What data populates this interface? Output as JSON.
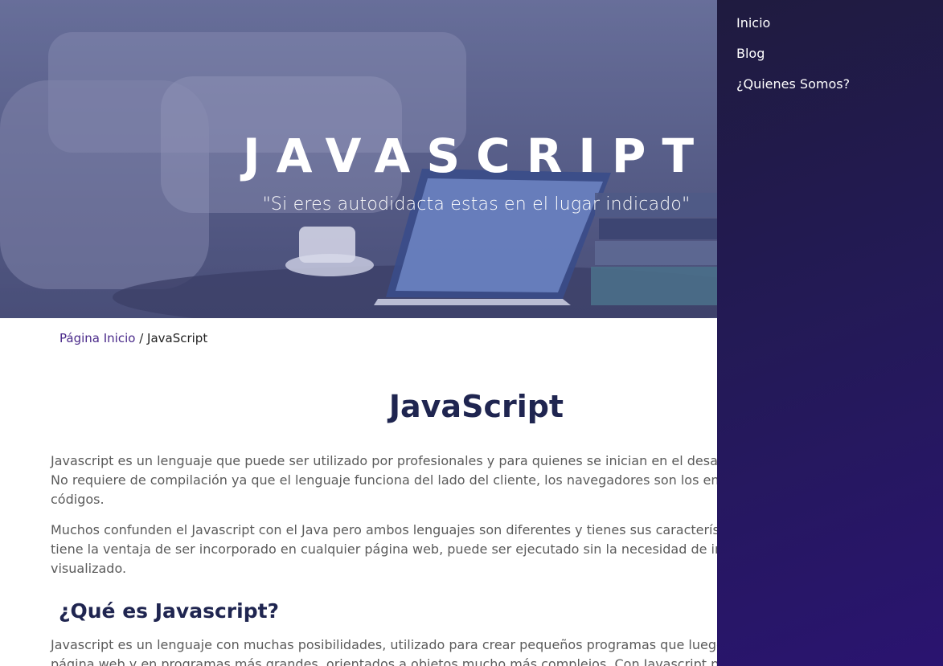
{
  "hero": {
    "title": "JAVASCRIPT",
    "subtitle": "\"Si eres autodidacta estas en el lugar indicado\""
  },
  "breadcrumb": {
    "home_label": "Página Inicio",
    "separator": " / ",
    "current": "JavaScript"
  },
  "main": {
    "title": "JavaScript",
    "paragraphs": [
      {
        "lines": [
          "Javascript es un lenguaje que puede ser utilizado por profesionales y para quienes se inician en el desarro",
          "No requiere de compilación ya que el lenguaje funciona del lado del cliente, los navegadores son los enca",
          "códigos."
        ]
      },
      {
        "lines": [
          "Muchos confunden el Javascript con el Java pero ambos lenguajes son diferentes y tienes sus característic",
          "tiene la ventaja de ser incorporado en cualquier página web, puede ser ejecutado sin la necesidad de inst",
          "visualizado."
        ]
      }
    ],
    "section_heading": "¿Qué es Javascript?",
    "section_paragraph": {
      "lines": [
        "Javascript es un lenguaje con muchas posibilidades, utilizado para crear pequeños programas que luego s",
        "página web y en programas más grandes, orientados a objetos mucho más complejos. Con Javascript po"
      ]
    }
  },
  "sidebar": {
    "items": [
      {
        "label": "Inicio"
      },
      {
        "label": "Blog"
      },
      {
        "label": "¿Quienes Somos?"
      }
    ]
  },
  "colors": {
    "sidebar_bg": "#231a55",
    "heading": "#1f2550",
    "link": "#4a2a8a"
  }
}
